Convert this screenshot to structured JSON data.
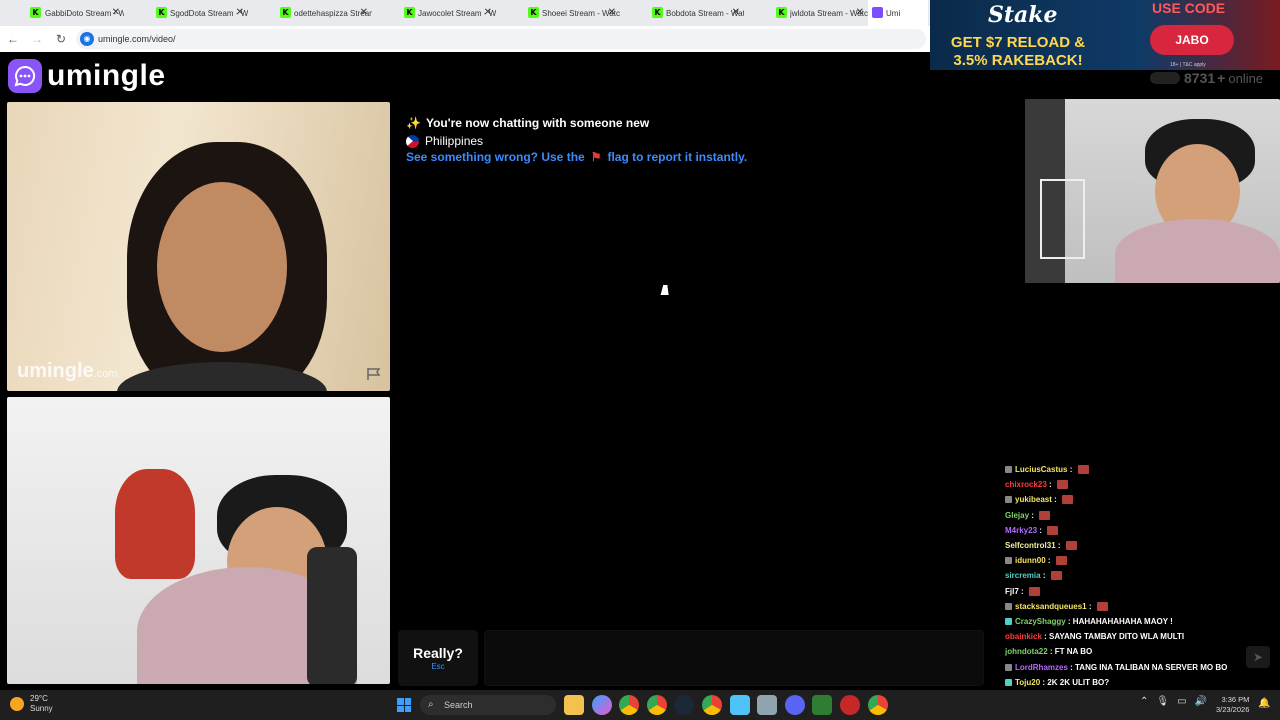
{
  "browser": {
    "tabs": [
      {
        "title": "GabbiDoto Stream - Wa",
        "favicon": "K"
      },
      {
        "title": "SgodDota Stream - Wat",
        "favicon": "K"
      },
      {
        "title": "odettehaspizza Stream",
        "favicon": "K"
      },
      {
        "title": "Jawocolet Stream - Wat",
        "favicon": "K"
      },
      {
        "title": "Shoeei Stream - Watch",
        "favicon": "K"
      },
      {
        "title": "Bobdota Stream - Watc",
        "favicon": "K"
      },
      {
        "title": "jwldota Stream - Watch",
        "favicon": "K"
      },
      {
        "title": "Umi",
        "favicon": "",
        "active": true
      }
    ],
    "url": "umingle.com/video/"
  },
  "ad": {
    "brand": "Stake",
    "promo": "GET $7 RELOAD & 3.5% RAKEBACK!",
    "use_code_label": "USE CODE",
    "code": "JABO",
    "fine_print": "18+ | T&C apply"
  },
  "site": {
    "logo_text": "umingle",
    "online_count": "8731",
    "online_plus": "+",
    "online_label": "online",
    "watermark": "umingle",
    "watermark_suffix": ".com"
  },
  "chat": {
    "system_line_1": "You're now chatting with someone new",
    "system_line_1_icon": "sparkles-icon",
    "country": "Philippines",
    "report_prefix": "See something wrong? Use the",
    "report_suffix": "flag to report it instantly.",
    "really_label": "Really?",
    "really_key": "Esc"
  },
  "stream_chat": [
    {
      "user": "LuciusCastus",
      "msg": "",
      "color": "#f5e663",
      "badge": "#888"
    },
    {
      "user": "chixrock23",
      "msg": "",
      "color": "#ff3b3b",
      "badge": ""
    },
    {
      "user": "yukibeast",
      "msg": "",
      "color": "#f5e663",
      "badge": "#888"
    },
    {
      "user": "Glejay",
      "msg": "",
      "color": "#7fd36b",
      "badge": ""
    },
    {
      "user": "M4rky23",
      "msg": "",
      "color": "#b36bff",
      "badge": ""
    },
    {
      "user": "Selfcontrol31",
      "msg": "",
      "color": "#f0f0a0",
      "badge": ""
    },
    {
      "user": "idunn00",
      "msg": "",
      "color": "#f5e663",
      "badge": "#888"
    },
    {
      "user": "sircremia",
      "msg": "",
      "color": "#4fd1c5",
      "badge": ""
    },
    {
      "user": "Fjl7",
      "msg": "",
      "color": "#ffffff",
      "badge": ""
    },
    {
      "user": "stacksandqueues1",
      "msg": "",
      "color": "#f5e663",
      "badge": "#888"
    },
    {
      "user": "CrazyShaggy",
      "msg": "HAHAHAHAHAHA MAOY !",
      "color": "#7fd36b",
      "badge": "#4fd1c5"
    },
    {
      "user": "obainkick",
      "msg": "SAYANG TAMBAY DITO WLA MULTI",
      "color": "#ff3b3b",
      "badge": ""
    },
    {
      "user": "johndota22",
      "msg": "FT NA BO",
      "color": "#7fd36b",
      "badge": ""
    },
    {
      "user": "LordRhamzes",
      "msg": "TANG INA TALIBAN NA SERVER MO BO",
      "color": "#b36bff",
      "badge": "#888"
    },
    {
      "user": "Toju20",
      "msg": "2K 2K ULIT BO?",
      "color": "#f5e663",
      "badge": "#4fd1c5"
    }
  ],
  "taskbar": {
    "temperature": "29°C",
    "condition": "Sunny",
    "search_placeholder": "Search",
    "time": "3:36 PM",
    "date": "3/23/2026"
  },
  "colors": {
    "accent": "#8a55f7",
    "link": "#3d8bfd",
    "kick_green": "#53fc18"
  }
}
